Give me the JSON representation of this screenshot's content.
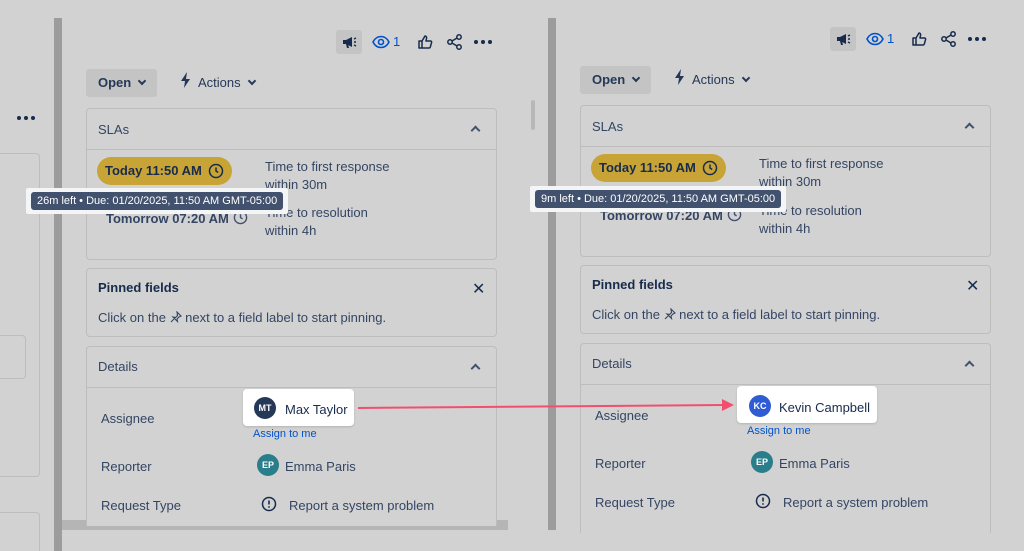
{
  "colors": {
    "accent_arrow": "#f0506e",
    "sla_badge": "#c8a436",
    "tooltip_bg": "#42526e",
    "link": "#0052cc"
  },
  "left": {
    "watch_count": "1",
    "status_button": "Open",
    "actions_label": "Actions",
    "slas_title": "SLAs",
    "sla1_badge": "Today 11:50 AM",
    "sla1_desc_line1": "Time to first response",
    "sla1_desc_line2": "within 30m",
    "tooltip": "26m left • Due: 01/20/2025, 11:50 AM GMT-05:00",
    "sla2_time": "Tomorrow 07:20 AM",
    "sla2_desc_line1": "Time to resolution",
    "sla2_desc_line2": "within 4h",
    "pinned_title": "Pinned fields",
    "pinned_text_pre": "Click on the",
    "pinned_text_post": "next to a field label to start pinning.",
    "details_title": "Details",
    "assignee_label": "Assignee",
    "assignee_initials": "MT",
    "assignee_name": "Max Taylor",
    "assign_to_me": "Assign to me",
    "reporter_label": "Reporter",
    "reporter_initials": "EP",
    "reporter_name": "Emma Paris",
    "request_type_label": "Request Type",
    "request_type_value": "Report a system problem"
  },
  "right": {
    "watch_count": "1",
    "status_button": "Open",
    "actions_label": "Actions",
    "slas_title": "SLAs",
    "sla1_badge": "Today 11:50 AM",
    "sla1_desc_line1": "Time to first response",
    "sla1_desc_line2": "within 30m",
    "tooltip": "9m left • Due: 01/20/2025, 11:50 AM GMT-05:00",
    "sla2_time": "Tomorrow 07:20 AM",
    "sla2_desc_line1": "Time to resolution",
    "sla2_desc_line2": "within 4h",
    "pinned_title": "Pinned fields",
    "pinned_text_pre": "Click on the",
    "pinned_text_post": "next to a field label to start pinning.",
    "details_title": "Details",
    "assignee_label": "Assignee",
    "assignee_initials": "KC",
    "assignee_name": "Kevin Campbell",
    "assign_to_me": "Assign to me",
    "reporter_label": "Reporter",
    "reporter_initials": "EP",
    "reporter_name": "Emma Paris",
    "request_type_label": "Request Type",
    "request_type_value": "Report a system problem"
  }
}
